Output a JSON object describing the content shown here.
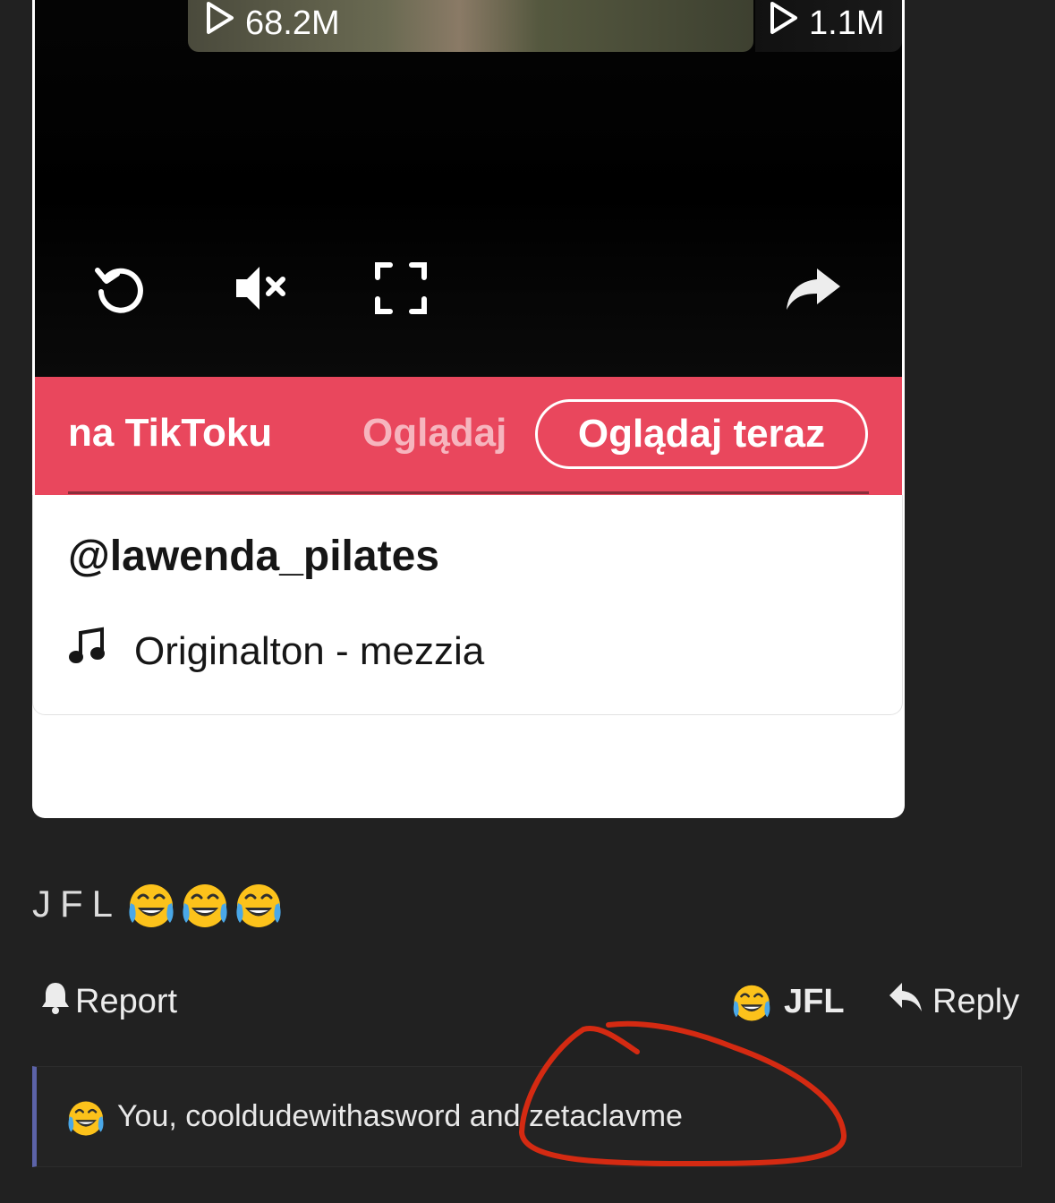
{
  "video": {
    "main_views": "68.2M",
    "side_views": "1.1M",
    "controls": [
      "replay-icon",
      "mute-icon",
      "fullscreen-icon",
      "share-icon"
    ]
  },
  "promo": {
    "scroll_text_a": "na TikToku",
    "scroll_text_b": "Oglądaj",
    "watch_button": "Oglądaj teraz",
    "color": "#e9475d"
  },
  "post": {
    "username": "@lawenda_pilates",
    "sound": "Originalton - mezzia"
  },
  "comment": {
    "text": "JFL",
    "emoji": "joy-emoji",
    "emoji_count": 3
  },
  "actions": {
    "report": "Report",
    "reaction_label": "JFL",
    "reply": "Reply"
  },
  "reactions": {
    "summary": "You, cooldudewithasword and zetaclavme",
    "accent": "#5c63a8"
  },
  "annotation": {
    "color": "#d42a12"
  }
}
